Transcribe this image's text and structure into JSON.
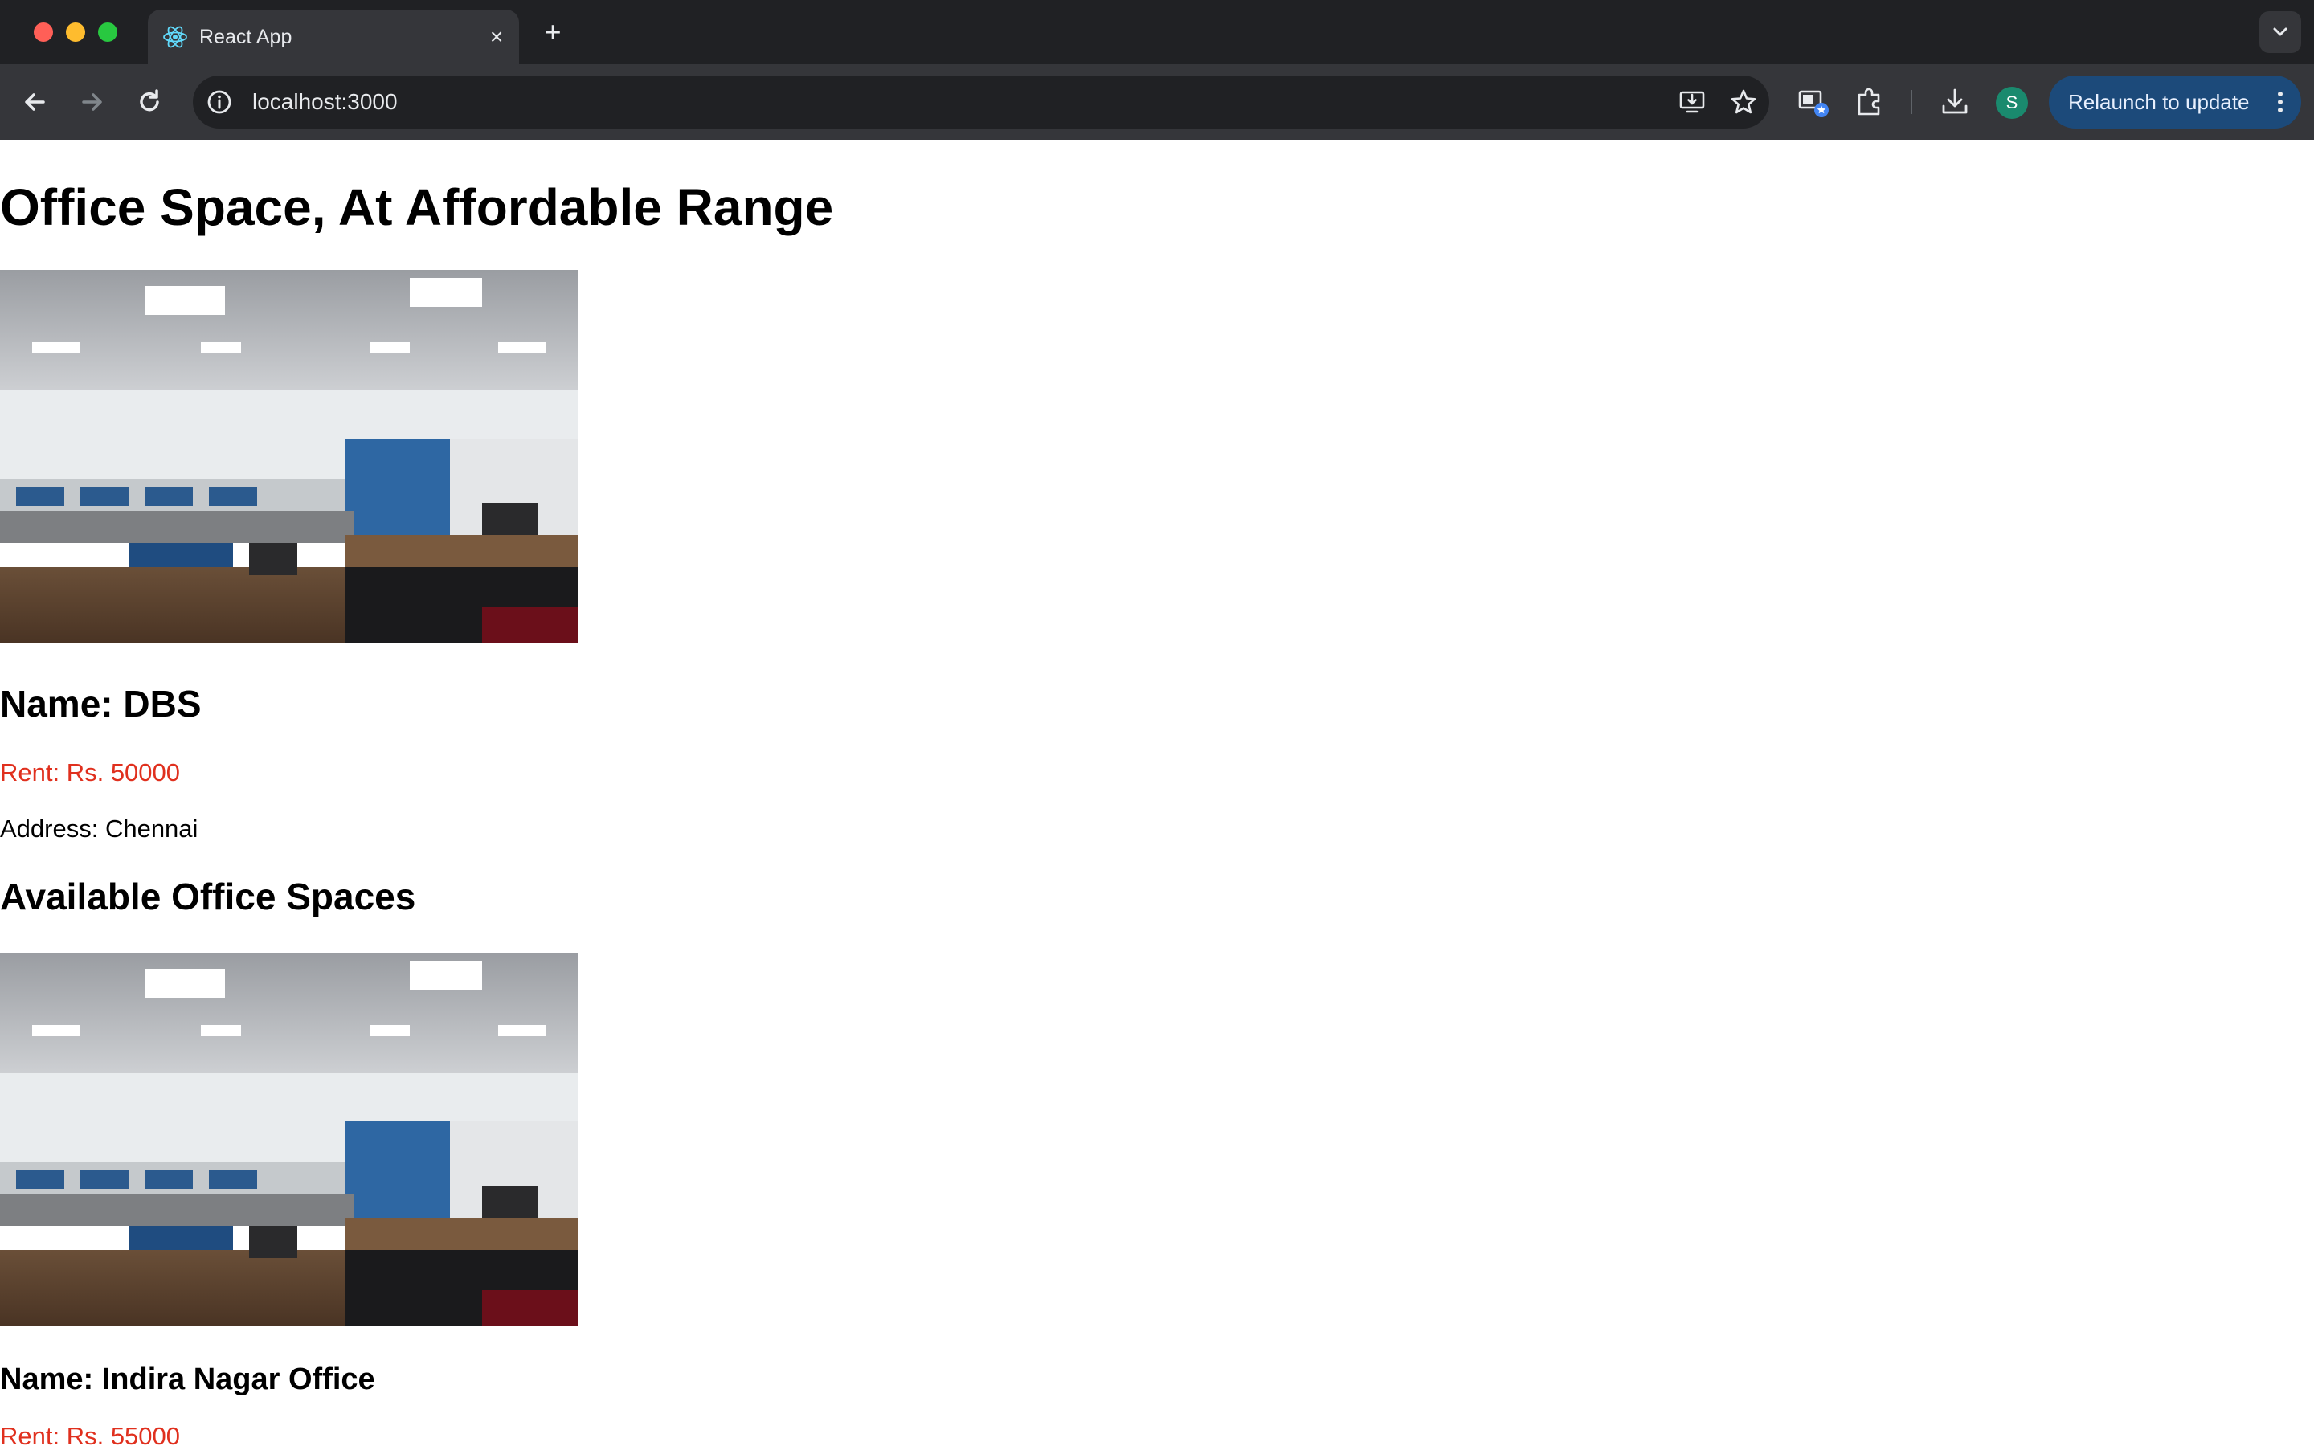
{
  "browser": {
    "tab": {
      "title": "React App"
    },
    "address_bar": {
      "url": "localhost:3000"
    },
    "profile_initial": "S",
    "relaunch_label": "Relaunch to update"
  },
  "page": {
    "title": "Office Space, At Affordable Range",
    "featured": {
      "name": "Name: DBS",
      "rent": "Rent: Rs. 50000",
      "address": "Address: Chennai",
      "rent_color": "#e0301e"
    },
    "section_title": "Available Office Spaces",
    "listings": [
      {
        "name": "Name: Indira Nagar Office",
        "rent": "Rent: Rs. 55000"
      }
    ]
  }
}
